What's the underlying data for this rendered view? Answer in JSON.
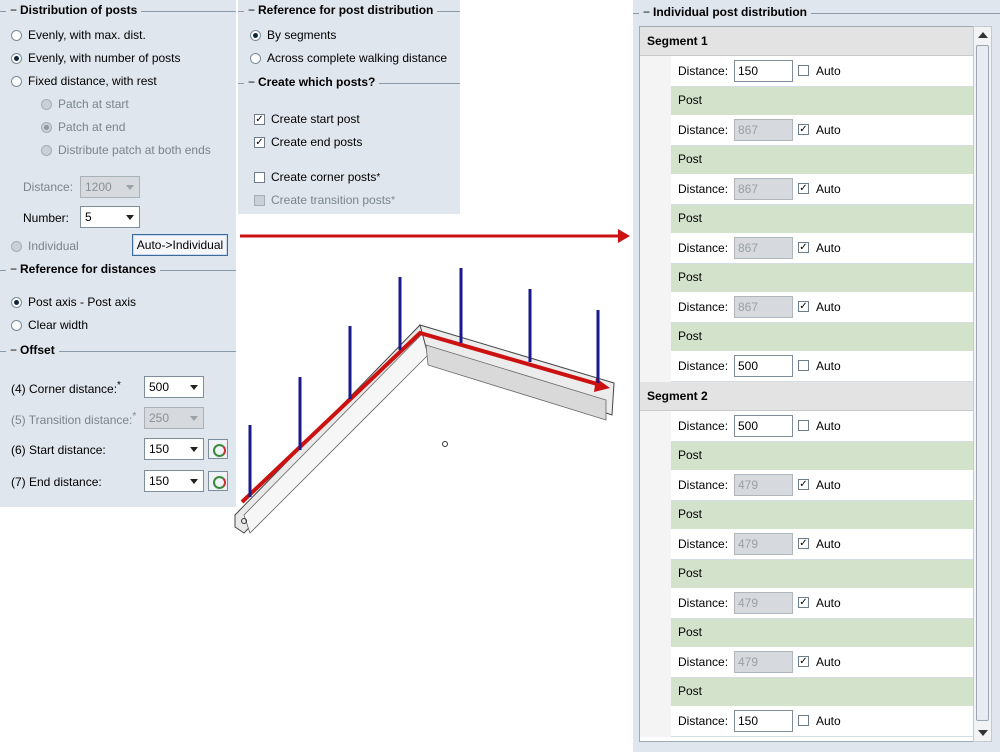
{
  "distribution": {
    "title": "Distribution of posts",
    "options": [
      "Evenly, with max. dist.",
      "Evenly, with number of posts",
      "Fixed distance, with rest"
    ],
    "selected": 1,
    "sub_options": [
      "Patch at start",
      "Patch at end",
      "Distribute patch at both ends"
    ],
    "distance_label": "Distance:",
    "distance_value": "1200",
    "number_label": "Number:",
    "number_value": "5",
    "individual_label": "Individual",
    "auto_button": "Auto->Individual"
  },
  "reference_distances": {
    "title": "Reference for distances",
    "options": [
      "Post axis - Post axis",
      "Clear width"
    ],
    "selected": 0
  },
  "offset": {
    "title": "Offset",
    "rows": [
      {
        "label": "(4) Corner distance:",
        "value": "500"
      },
      {
        "label": "(5) Transition distance:",
        "value": "250"
      },
      {
        "label": "(6) Start distance:",
        "value": "150"
      },
      {
        "label": "(7) End distance:",
        "value": "150"
      }
    ]
  },
  "reference_post": {
    "title": "Reference for post distribution",
    "options": [
      "By segments",
      "Across complete walking distance"
    ],
    "selected": 0
  },
  "which_posts": {
    "title": "Create which posts?",
    "items": [
      {
        "label": "Create start post",
        "checked": true
      },
      {
        "label": "Create end posts",
        "checked": true
      },
      {
        "label": "Create corner posts",
        "checked": false
      },
      {
        "label": "Create transition posts",
        "checked": false
      }
    ]
  },
  "individual": {
    "title": "Individual post distribution",
    "distance_label": "Distance:",
    "auto_label": "Auto",
    "post_label": "Post",
    "segments": [
      {
        "name": "Segment 1",
        "distances": [
          {
            "value": "150",
            "auto": false
          },
          {
            "value": "867",
            "auto": true
          },
          {
            "value": "867",
            "auto": true
          },
          {
            "value": "867",
            "auto": true
          },
          {
            "value": "867",
            "auto": true
          },
          {
            "value": "500",
            "auto": false
          }
        ]
      },
      {
        "name": "Segment 2",
        "distances": [
          {
            "value": "500",
            "auto": false
          },
          {
            "value": "479",
            "auto": true
          },
          {
            "value": "479",
            "auto": true
          },
          {
            "value": "479",
            "auto": true
          },
          {
            "value": "479",
            "auto": true
          },
          {
            "value": "150",
            "auto": false
          }
        ]
      }
    ]
  },
  "colors": {
    "panel": "#dfe6ee",
    "post_row": "#d3e3cb",
    "arrow": "#cc1111",
    "posts": "#1a1a8c"
  }
}
